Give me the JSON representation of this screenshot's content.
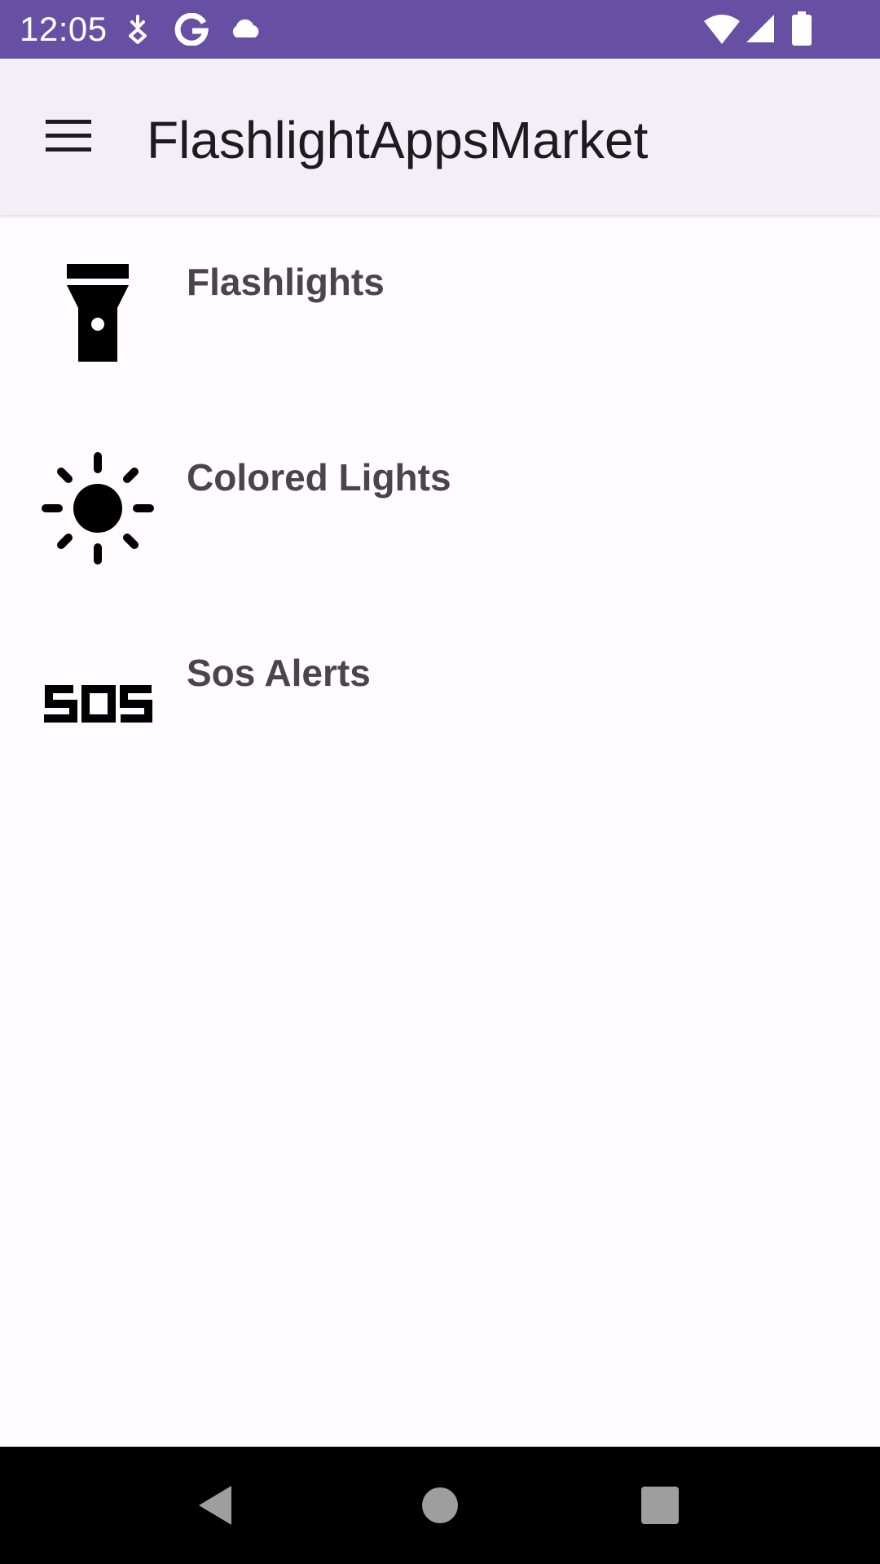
{
  "status_bar": {
    "time": "12:05",
    "left_icons": [
      "download-notification-icon",
      "google-icon",
      "cloud-icon"
    ],
    "right_icons": [
      "wifi-icon",
      "cellular-signal-icon",
      "battery-icon"
    ],
    "background": "#6750a4"
  },
  "app_bar": {
    "menu_icon": "hamburger-menu-icon",
    "title": "FlashlightAppsMarket",
    "background": "#f3eff7"
  },
  "categories": [
    {
      "label": "Flashlights",
      "icon": "flashlight-icon"
    },
    {
      "label": "Colored Lights",
      "icon": "sun-icon"
    },
    {
      "label": "Sos Alerts",
      "icon": "sos-icon"
    }
  ],
  "nav_bar": {
    "buttons": [
      "back-icon",
      "home-icon",
      "recents-icon"
    ],
    "background": "#000000"
  },
  "colors": {
    "accent": "#6750a4",
    "label_text": "#49454f",
    "title_text": "#1c1b1f",
    "page_background": "#fffbfe"
  }
}
